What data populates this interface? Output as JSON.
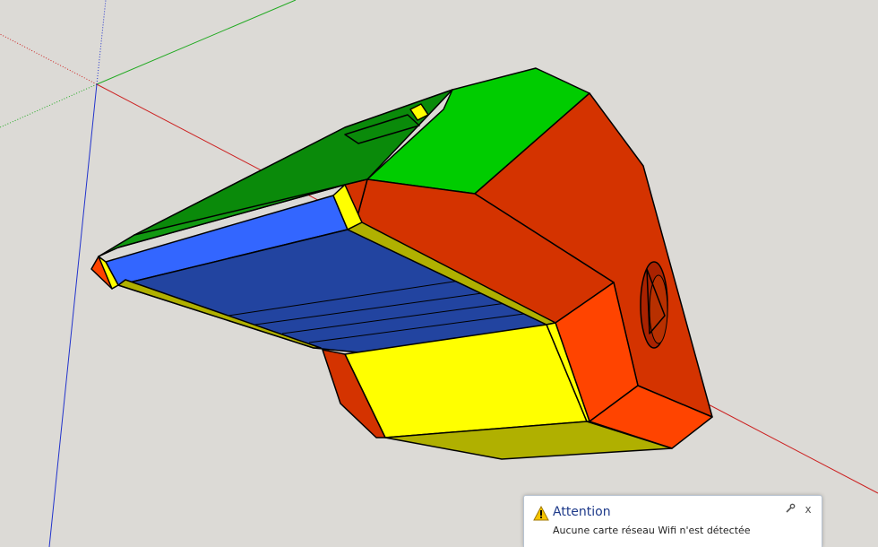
{
  "viewport": {
    "background": "#dcdad6",
    "axis_colors": {
      "red": "#d02020",
      "green": "#20a020",
      "blue": "#2020c0"
    },
    "face_colors": {
      "green": "#00cc00",
      "dark_green": "#0a8a0a",
      "red": "#d43300",
      "orange": "#ff4400",
      "blue": "#3366ff",
      "dark_blue": "#2244a0",
      "yellow": "#ffff00",
      "olive": "#b0b000"
    }
  },
  "notification": {
    "title": "Attention",
    "message": "Aucune carte réseau Wifi n'est détectée",
    "warning_icon": "warning-triangle-icon",
    "options_icon": "wrench-icon",
    "close_icon": "close-icon",
    "close_label": "x"
  }
}
